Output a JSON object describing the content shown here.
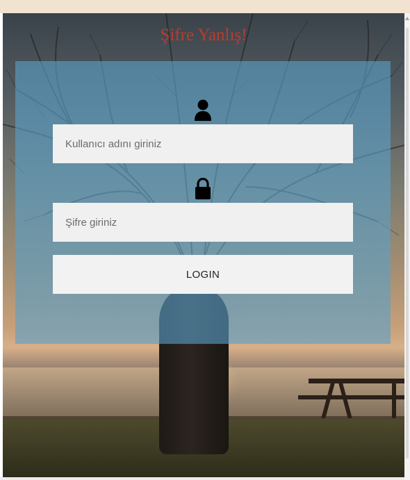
{
  "page": {
    "title": "Şifre Yanlış!",
    "title_color": "#c0392b"
  },
  "form": {
    "username": {
      "icon": "user-icon",
      "placeholder": "Kullanıcı adını giriniz",
      "value": ""
    },
    "password": {
      "icon": "lock-icon",
      "placeholder": "Şifre giriniz",
      "value": ""
    },
    "login_label": "LOGIN"
  },
  "colors": {
    "panel": "#5aa0c8",
    "field_bg": "#f0f0f0"
  }
}
